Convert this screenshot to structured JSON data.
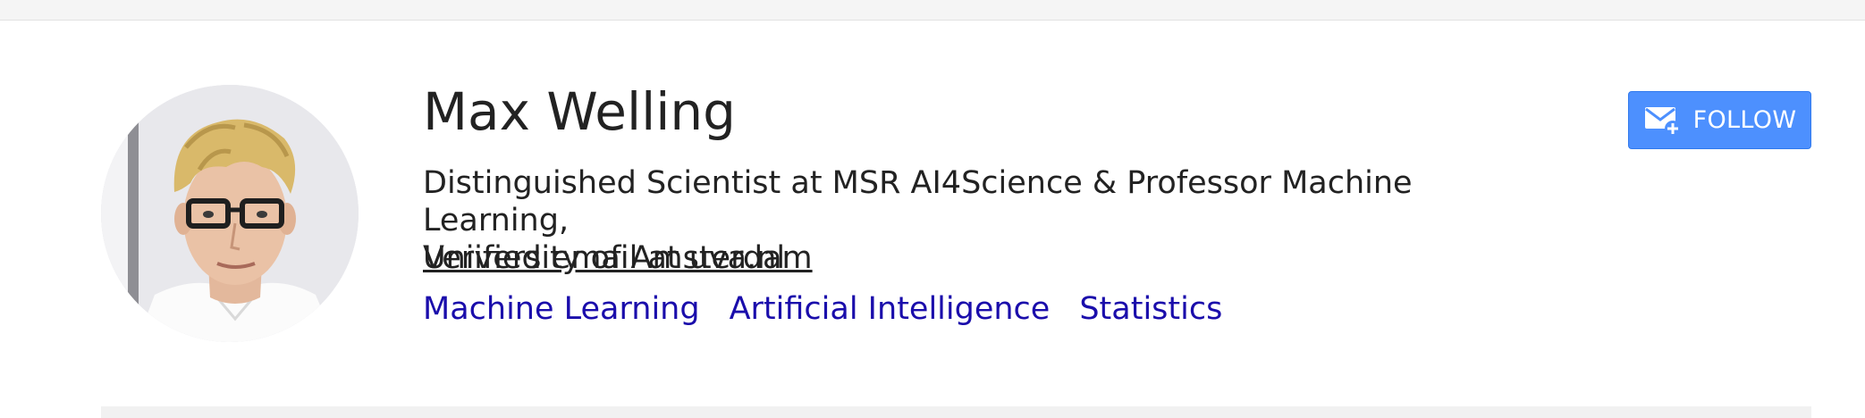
{
  "profile": {
    "name": "Max Welling",
    "affiliation_text": "Distinguished Scientist at MSR AI4Science & Professor Machine Learning,",
    "affiliation_link": "University of Amsterdam",
    "email": "Verified email at uva.nl",
    "interests": [
      "Machine Learning",
      "Artificial Intelligence",
      "Statistics"
    ]
  },
  "actions": {
    "follow_label": "FOLLOW"
  },
  "icons": {
    "follow": "email-plus-icon",
    "avatar": "profile-photo"
  },
  "colors": {
    "follow_button": "#4d90fe",
    "interest_link": "#1a0dab",
    "text": "#222222"
  }
}
